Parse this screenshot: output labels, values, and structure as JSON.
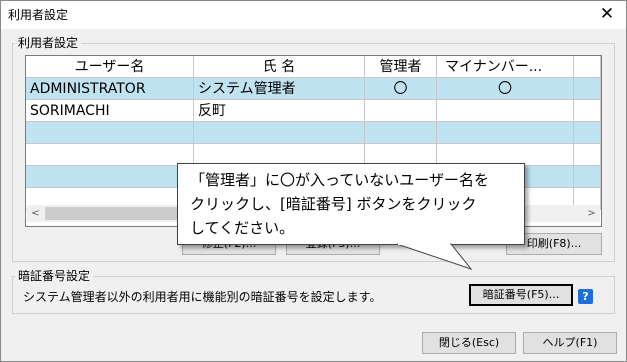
{
  "window": {
    "title": "利用者設定",
    "close_glyph": "✕"
  },
  "user_group": {
    "label": "利用者設定"
  },
  "grid": {
    "columns": [
      "ユーザー名",
      "氏 名",
      "管理者",
      "マイナンバー..."
    ],
    "rows": [
      {
        "user": "ADMINISTRATOR",
        "name": "システム管理者",
        "admin": "〇",
        "mynumber": "〇"
      },
      {
        "user": "SORIMACHI",
        "name": "反町",
        "admin": "",
        "mynumber": ""
      }
    ]
  },
  "scroll": {
    "left": "<",
    "right": ">"
  },
  "buttons": {
    "edit": "修正(F2)...",
    "register": "登録(F3)...",
    "print": "印刷(F8)...",
    "pin": "暗証番号(F5)...",
    "close": "閉じる(Esc)",
    "help": "ヘルプ(F1)"
  },
  "pin_group": {
    "label": "暗証番号設定",
    "description": "システム管理者以外の利用者用に機能別の暗証番号を設定します。",
    "help_icon_glyph": "?"
  },
  "callout": {
    "line1": "「管理者」に〇が入っていないユーザー名を",
    "line2": "クリックし、[暗証番号] ボタンをクリック",
    "line3": "してください。"
  }
}
